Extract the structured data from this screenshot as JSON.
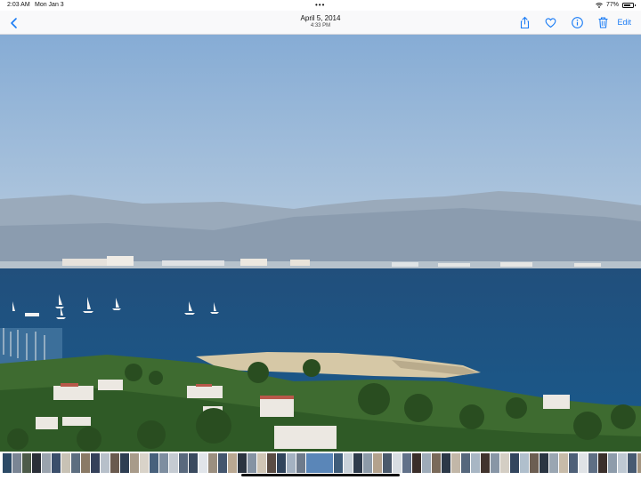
{
  "status_bar": {
    "time": "2:03 AM",
    "date": "Mon Jan 3",
    "battery_percent": "77%",
    "battery_level": 0.77,
    "icons": [
      "wifi-icon",
      "battery-icon"
    ]
  },
  "nav": {
    "title": "April 5, 2014",
    "subtitle": "4:33 PM",
    "back_icon": "chevron-left-icon",
    "actions": [
      "share-icon",
      "heart-icon",
      "info-icon",
      "trash-icon"
    ],
    "edit_label": "Edit",
    "accent_color": "#1a7cf5"
  },
  "photo": {
    "subject": "bay-with-sailboats-and-coastline",
    "colors": {
      "sky_top": "#86acd5",
      "sky_bottom": "#bacddf",
      "mountains": "#8e9fb3",
      "sea": "#1c5787",
      "sand": "#d6c8a6",
      "vegetation": "#2f5a26"
    }
  },
  "thumbnail_strip": {
    "selected_index": 31,
    "thumb_colors": [
      "#2c4a66",
      "#7a8594",
      "#4d5b4a",
      "#2a2f38",
      "#9aa3ad",
      "#3b4f6b",
      "#c8c2b5",
      "#5d6e80",
      "#8a7a66",
      "#35415a",
      "#b7c0ca",
      "#6a5a4e",
      "#2e3e52",
      "#a89b8a",
      "#d9d3c9",
      "#48617c",
      "#7e8ea0",
      "#c5cbd2",
      "#59697d",
      "#3a4a5f",
      "#e1e5ea",
      "#9b8f80",
      "#44566e",
      "#b9a892",
      "#2b3440",
      "#8593a3",
      "#d0c6b6",
      "#5a4c44",
      "#30445c",
      "#a4b2c2",
      "#6e7b8c",
      "#5a86b8",
      "#3f5d7a",
      "#c9d2da",
      "#2f3c4d",
      "#8c9aa8",
      "#b3a28d",
      "#4b5a6c",
      "#d8dde2",
      "#62728a",
      "#3a2e2a",
      "#9eabb8",
      "#7a6a5a",
      "#2c3847",
      "#c2b7a8",
      "#56677c",
      "#a8b6c4",
      "#41332d",
      "#8896a6",
      "#d4cec4",
      "#33465e",
      "#b0bfcc",
      "#6c5e52",
      "#2a3542",
      "#9aa6b2",
      "#c7bba9",
      "#4e6078",
      "#e0e3e6",
      "#5f6f84",
      "#3b2f2b",
      "#8e9cab",
      "#bfc9d3",
      "#475a72",
      "#a39480",
      "#2e3a4a",
      "#d2d7dc",
      "#687a90",
      "#514338",
      "#9fb0c1",
      "#c4cdd6"
    ]
  }
}
